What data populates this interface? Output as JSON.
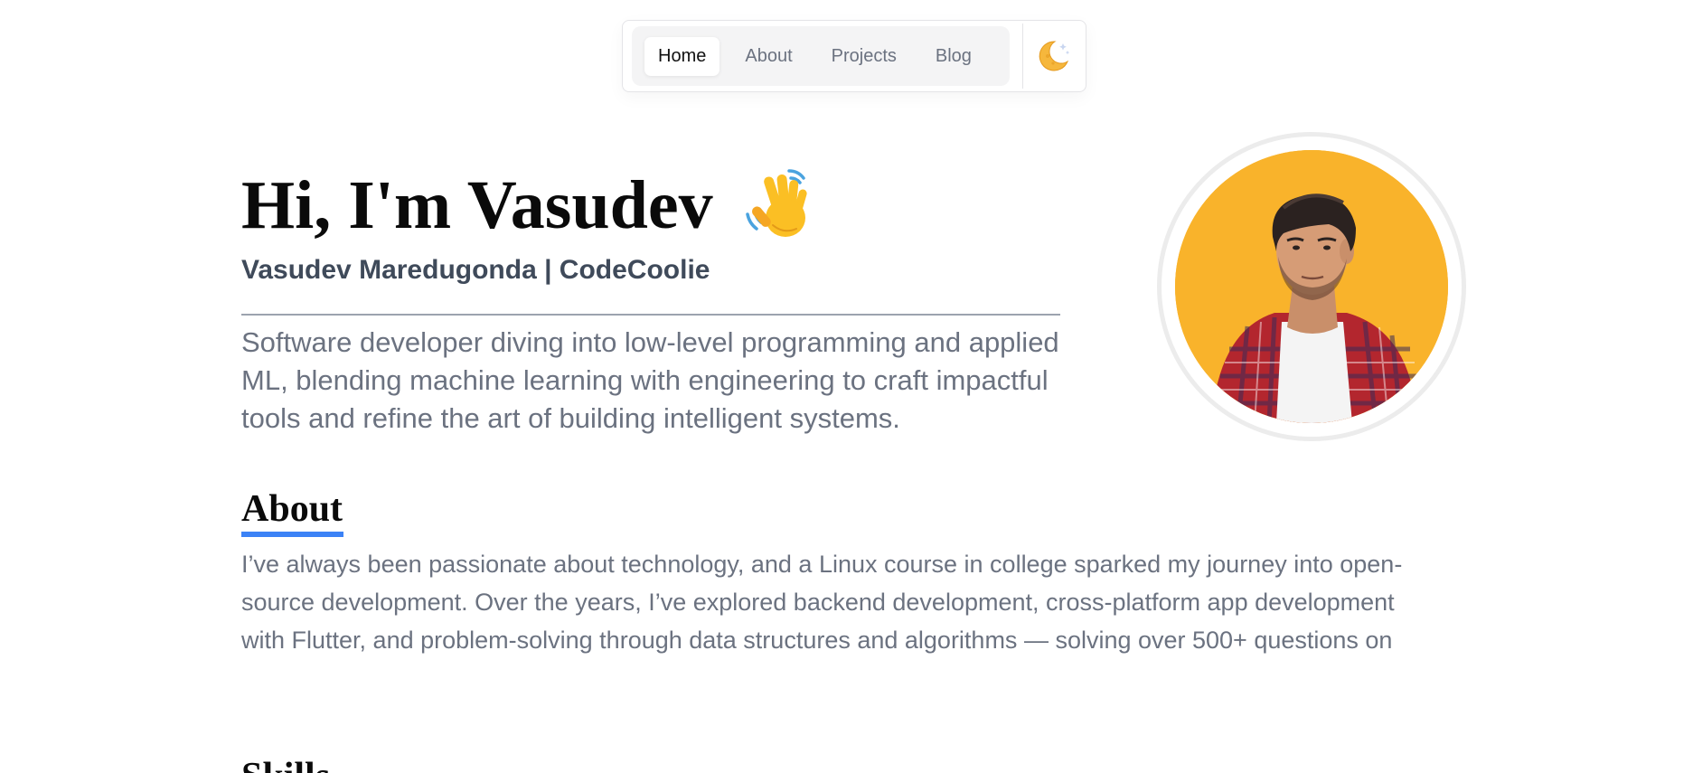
{
  "nav": {
    "tabs": [
      {
        "label": "Home",
        "active": true
      },
      {
        "label": "About",
        "active": false
      },
      {
        "label": "Projects",
        "active": false
      },
      {
        "label": "Blog",
        "active": false
      }
    ],
    "theme_toggle_icon": "moon-stars-icon"
  },
  "hero": {
    "title": "Hi, I'm Vasudev",
    "title_icon": "waving-hand-icon",
    "subtitle": "Vasudev Maredugonda | CodeCoolie",
    "intro": "Software developer diving into low-level programming and applied ML, blending machine learning with engineering to craft impactful tools and refine the art of building intelligent systems.",
    "avatar_icon": "profile-photo",
    "avatar_bg_color": "#f9b32b"
  },
  "about": {
    "heading": "About",
    "text": "I’ve always been passionate about technology, and a Linux course in college sparked my journey into open-source development. Over the years, I’ve explored backend development, cross-platform app development with Flutter, and problem-solving through data structures and algorithms — solving over 500+ questions on",
    "accent_color": "#3b82f6"
  },
  "skills": {
    "heading": "Skills"
  }
}
